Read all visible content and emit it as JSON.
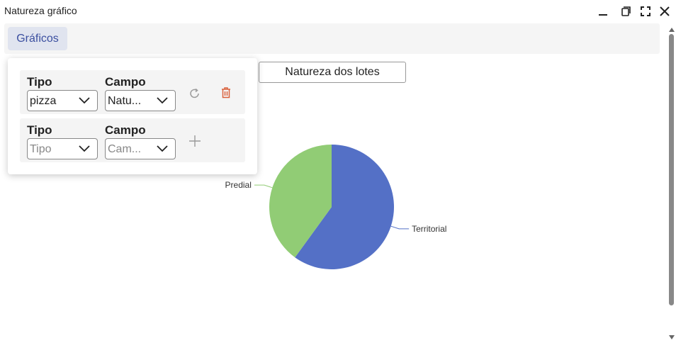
{
  "window": {
    "title": "Natureza gráfico",
    "buttons": [
      "minimize-icon",
      "restore-icon",
      "fullscreen-icon",
      "close-icon"
    ]
  },
  "toolbar": {
    "graficos_label": "Gráficos"
  },
  "popup": {
    "rows": [
      {
        "tipo_label": "Tipo",
        "tipo_value": "pizza",
        "campo_label": "Campo",
        "campo_value": "Natu...",
        "actions": [
          "refresh-icon",
          "trash-icon"
        ]
      },
      {
        "tipo_label": "Tipo",
        "tipo_placeholder": "Tipo",
        "campo_label": "Campo",
        "campo_placeholder": "Cam...",
        "actions": [
          "plus-icon"
        ]
      }
    ]
  },
  "colors": {
    "accent": "#3b4fa0",
    "delete": "#d9603b",
    "series_territorial": "#5470c6",
    "series_predial": "#91cc75"
  },
  "chart_title_button": "Natureza dos lotes",
  "chart_data": {
    "type": "pie",
    "title": "Natureza dos lotes",
    "categories": [
      "Territorial",
      "Predial"
    ],
    "values": [
      60,
      40
    ],
    "colors": [
      "#5470c6",
      "#91cc75"
    ]
  }
}
